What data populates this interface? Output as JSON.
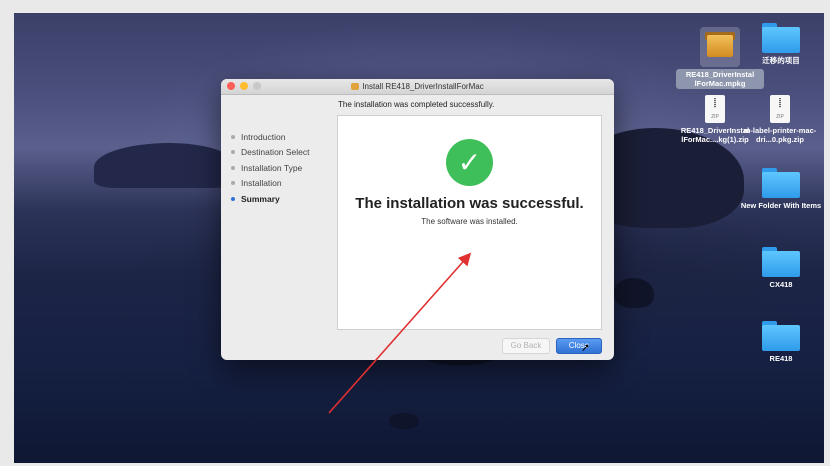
{
  "window": {
    "title": "Install RE418_DriverInstallForMac",
    "header_message": "The installation was completed successfully.",
    "steps": [
      {
        "label": "Introduction"
      },
      {
        "label": "Destination Select"
      },
      {
        "label": "Installation Type"
      },
      {
        "label": "Installation"
      },
      {
        "label": "Summary",
        "active": true
      }
    ],
    "success_title": "The installation was successful.",
    "success_subtitle": "The software was installed.",
    "check_glyph": "✓",
    "buttons": {
      "go_back": "Go Back",
      "close": "Close"
    }
  },
  "desktop_icons": [
    {
      "label": "RE418_DriverInstal lForMac.mpkg",
      "type": "package-icon"
    },
    {
      "label": "迁移的项目",
      "type": "folder-icon"
    },
    {
      "label": "RE418_DriverInstal lForMac....kg(1).zip",
      "type": "zip-icon"
    },
    {
      "label": "m-label-printer-mac-dri...0.pkg.zip",
      "type": "zip-icon"
    },
    {
      "label": "New Folder With Items",
      "type": "folder-icon"
    },
    {
      "label": "CX418",
      "type": "folder-icon"
    },
    {
      "label": "RE418",
      "type": "folder-icon"
    }
  ],
  "zip_badge": "ZIP",
  "colors": {
    "accent": "#2f71d3",
    "success": "#3fbf5a",
    "annotation_arrow": "#e03030"
  }
}
